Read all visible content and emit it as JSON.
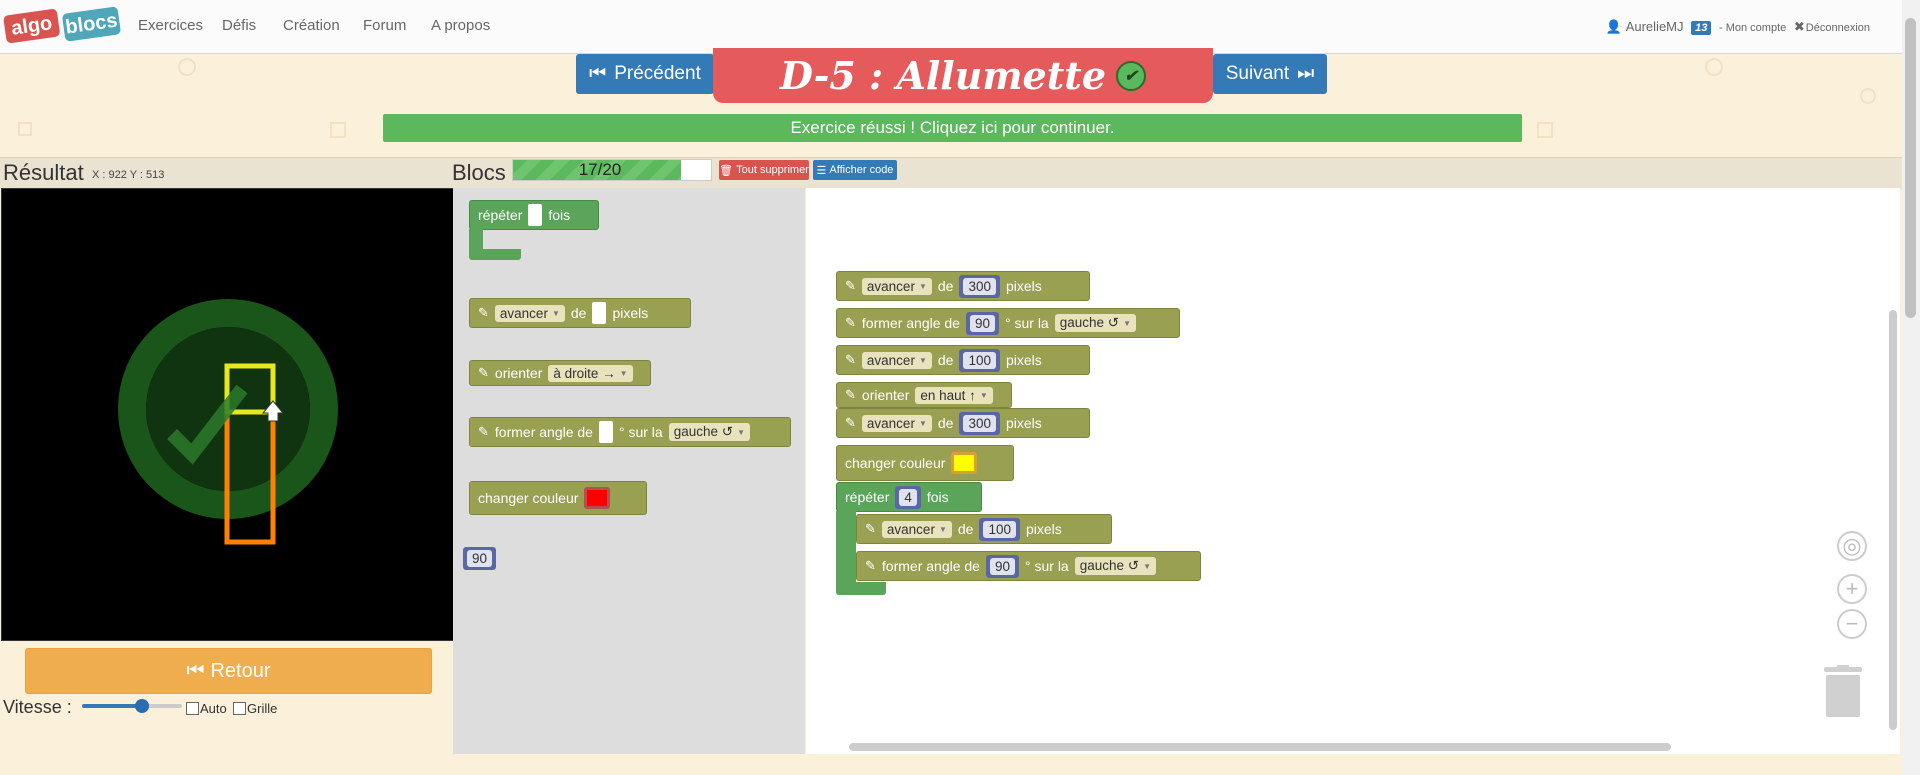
{
  "nav": {
    "logo_left": "algo",
    "logo_right": "blocs",
    "links": [
      "Exercices",
      "Défis",
      "Création",
      "Forum",
      "A propos"
    ],
    "user": "AurelieMJ",
    "user_badge": "13",
    "account": "- Mon compte",
    "logout": "Déconnexion"
  },
  "header": {
    "prev_label": "Précédent",
    "next_label": "Suivant",
    "title": "D-5 : Allumette",
    "success_message": "Exercice réussi ! Cliquez ici pour continuer."
  },
  "result": {
    "title": "Résultat",
    "coords": "X : 922 Y : 513",
    "retour_label": "Retour",
    "speed_label": "Vitesse :",
    "speed_value": 0.6,
    "auto_label": "Auto",
    "grid_label": "Grille"
  },
  "blocks_panel": {
    "title": "Blocs",
    "progress_text": "17/20",
    "progress_fraction": 0.85,
    "delete_all": "Tout supprimer",
    "show_code": "Afficher code"
  },
  "toolbox": {
    "repeat": {
      "pre": "répéter",
      "post": "fois"
    },
    "advance": {
      "dropdown": "avancer",
      "de": "de",
      "unit": "pixels"
    },
    "orient": {
      "label": "orienter",
      "dropdown": "à droite →"
    },
    "turn": {
      "label": "former angle de",
      "mid": "° sur la",
      "dropdown": "gauche ↺"
    },
    "color": {
      "label": "changer couleur",
      "value": "#ff0000"
    },
    "number": "90"
  },
  "program": {
    "b1": {
      "dropdown": "avancer",
      "de": "de",
      "value": "300",
      "unit": "pixels"
    },
    "b2": {
      "label": "former angle de",
      "value": "90",
      "mid": "° sur la",
      "dropdown": "gauche ↺"
    },
    "b3": {
      "dropdown": "avancer",
      "de": "de",
      "value": "100",
      "unit": "pixels"
    },
    "b4": {
      "label": "orienter",
      "dropdown": "en haut ↑"
    },
    "b5": {
      "dropdown": "avancer",
      "de": "de",
      "value": "300",
      "unit": "pixels"
    },
    "b6": {
      "label": "changer couleur",
      "value": "#ffff00"
    },
    "b7": {
      "pre": "répéter",
      "value": "4",
      "post": "fois"
    },
    "b8": {
      "dropdown": "avancer",
      "de": "de",
      "value": "100",
      "unit": "pixels"
    },
    "b9": {
      "label": "former angle de",
      "value": "90",
      "mid": "° sur la",
      "dropdown": "gauche ↺"
    }
  },
  "colors": {
    "success": "#5cb85c",
    "primary": "#337ab7",
    "danger": "#d9534f",
    "warning": "#f0ad4e",
    "motion_block": "#9aa052",
    "loop_block": "#5ba55b",
    "title_banner": "#e55a5a"
  }
}
